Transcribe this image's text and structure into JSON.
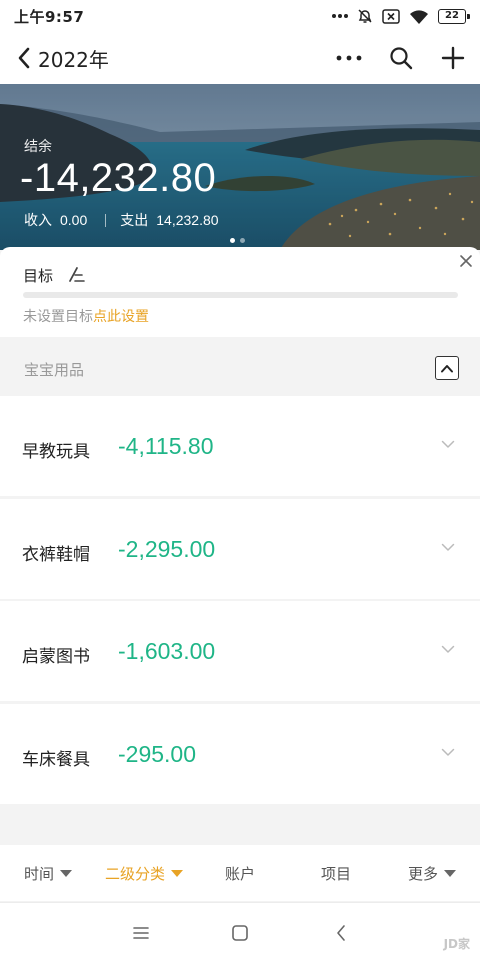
{
  "status_bar": {
    "time": "上午9:57",
    "battery": "22"
  },
  "nav": {
    "title": "2022年"
  },
  "banner": {
    "balance_label": "结余",
    "balance_value": "-14,232.80",
    "income_label": "收入",
    "income_value": "0.00",
    "expense_label": "支出",
    "expense_value": "14,232.80"
  },
  "goal": {
    "title": "目标",
    "message": "未设置目标",
    "link": "点此设置"
  },
  "category": {
    "title": "宝宝用品"
  },
  "items": [
    {
      "name": "早教玩具",
      "amount": "-4,115.80"
    },
    {
      "name": "衣裤鞋帽",
      "amount": "-2,295.00"
    },
    {
      "name": "启蒙图书",
      "amount": "-1,603.00"
    },
    {
      "name": "车床餐具",
      "amount": "-295.00"
    }
  ],
  "filters": [
    {
      "label": "时间",
      "dropdown": true,
      "active": false
    },
    {
      "label": "二级分类",
      "dropdown": true,
      "active": true
    },
    {
      "label": "账户",
      "dropdown": false,
      "active": false
    },
    {
      "label": "项目",
      "dropdown": false,
      "active": false
    },
    {
      "label": "更多",
      "dropdown": true,
      "active": false
    }
  ],
  "watermark": "JD家",
  "colors": {
    "amount_green": "#1fb587",
    "accent_orange": "#e8a325"
  }
}
